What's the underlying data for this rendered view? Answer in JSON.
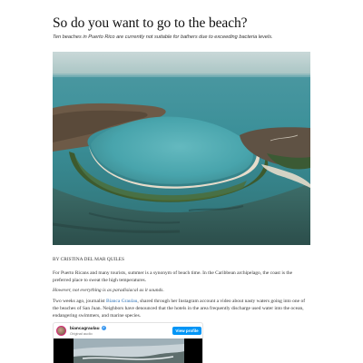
{
  "article": {
    "title": "So do you want to go to the beach?",
    "subtitle": "Ten beaches in Puerto Rico are currently not suitable for bathers due to exceeding bacteria levels.",
    "byline": "BY CRISTINA DEL MAR QUILES",
    "paragraphs": {
      "p1": "For Puerto Ricans and many tourists, summer is a synonym of beach time. In the Caribbean archipelago, the coast is the preferred place to sweat the high temperatures.",
      "p2": "However, not everything is as paradisiacal as it sounds.",
      "p3_before": "Two weeks ago, journalist ",
      "p3_link": "Bianca Graulau",
      "p3_after": ", shared through her Instagram account a video about nasty waters going into one of the beaches of San Juan. Neighbors have denounced that the hotels in the area frequently discharge used water into the ocean, endangering swimmers, and marine species."
    }
  },
  "embed": {
    "username": "biancagraulau",
    "verified_mark": "✓",
    "audio_label": "Original audio",
    "view_profile_label": "View profile"
  },
  "colors": {
    "link": "#2a6fb5",
    "button": "#0095f6",
    "water": "#3a9aa3"
  },
  "icons": {
    "verified": "verified-badge-icon",
    "avatar": "profile-avatar"
  }
}
